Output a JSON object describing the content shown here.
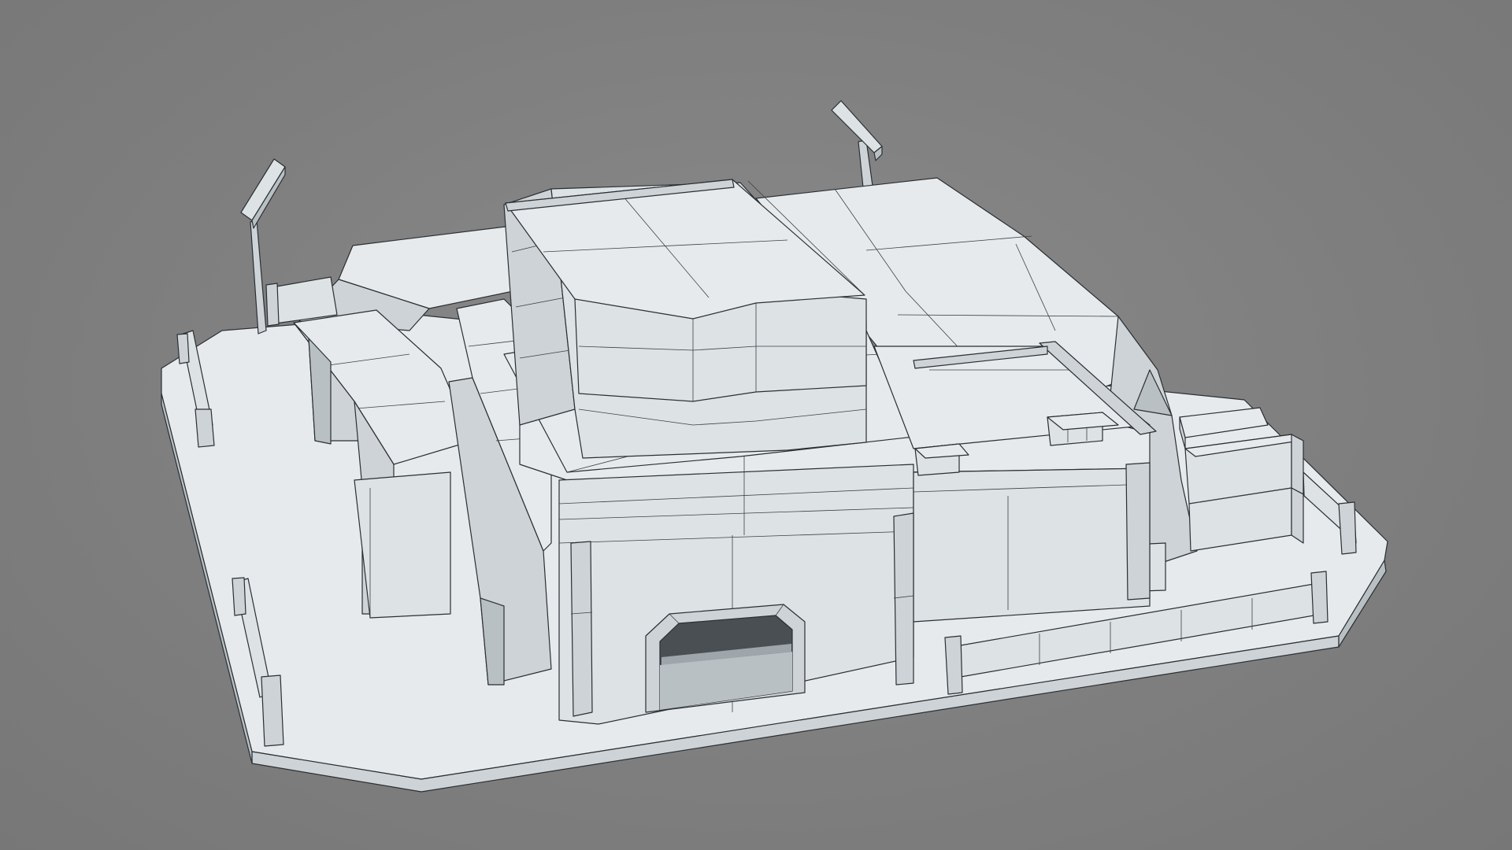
{
  "scene": {
    "background_color": "#808080",
    "model_color": "#e2e7ea",
    "wire_color": "#2a2f33",
    "objects": [
      {
        "name": "ground-slab"
      },
      {
        "name": "bunker-main-body"
      },
      {
        "name": "bunker-entrance-arch"
      },
      {
        "name": "roof-tower-block"
      },
      {
        "name": "upper-roof-deck"
      },
      {
        "name": "side-ramp"
      },
      {
        "name": "supply-crates"
      },
      {
        "name": "floodlight-post-left"
      },
      {
        "name": "floodlight-post-right"
      },
      {
        "name": "perimeter-barrier-walls"
      }
    ]
  }
}
